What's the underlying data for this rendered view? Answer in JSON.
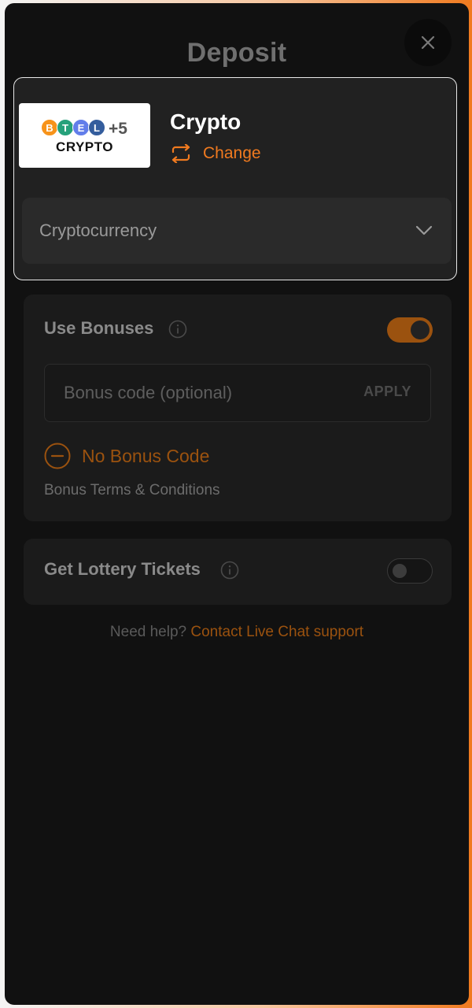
{
  "header": {
    "title": "Deposit",
    "close_icon": "close-icon"
  },
  "payment_method": {
    "logo": {
      "coins": [
        "B",
        "T",
        "E",
        "L"
      ],
      "coin_colors": [
        "#f7931a",
        "#26a17b",
        "#627eea",
        "#345d9d"
      ],
      "more_count": "+5",
      "word": "CRYPTO"
    },
    "name": "Crypto",
    "change_label": "Change",
    "currency_select": {
      "value": "Cryptocurrency"
    }
  },
  "bonuses": {
    "title": "Use Bonuses",
    "toggle_on": true,
    "code_placeholder": "Bonus code (optional)",
    "apply_label": "APPLY",
    "no_bonus_label": "No Bonus Code",
    "terms_label": "Bonus Terms & Conditions"
  },
  "lottery": {
    "title": "Get Lottery Tickets",
    "toggle_on": false
  },
  "help": {
    "prefix": "Need help?",
    "link": "Contact Live Chat support"
  },
  "colors": {
    "accent": "#f07a1f",
    "accent_dim": "#9b520f",
    "background": "#111111"
  }
}
